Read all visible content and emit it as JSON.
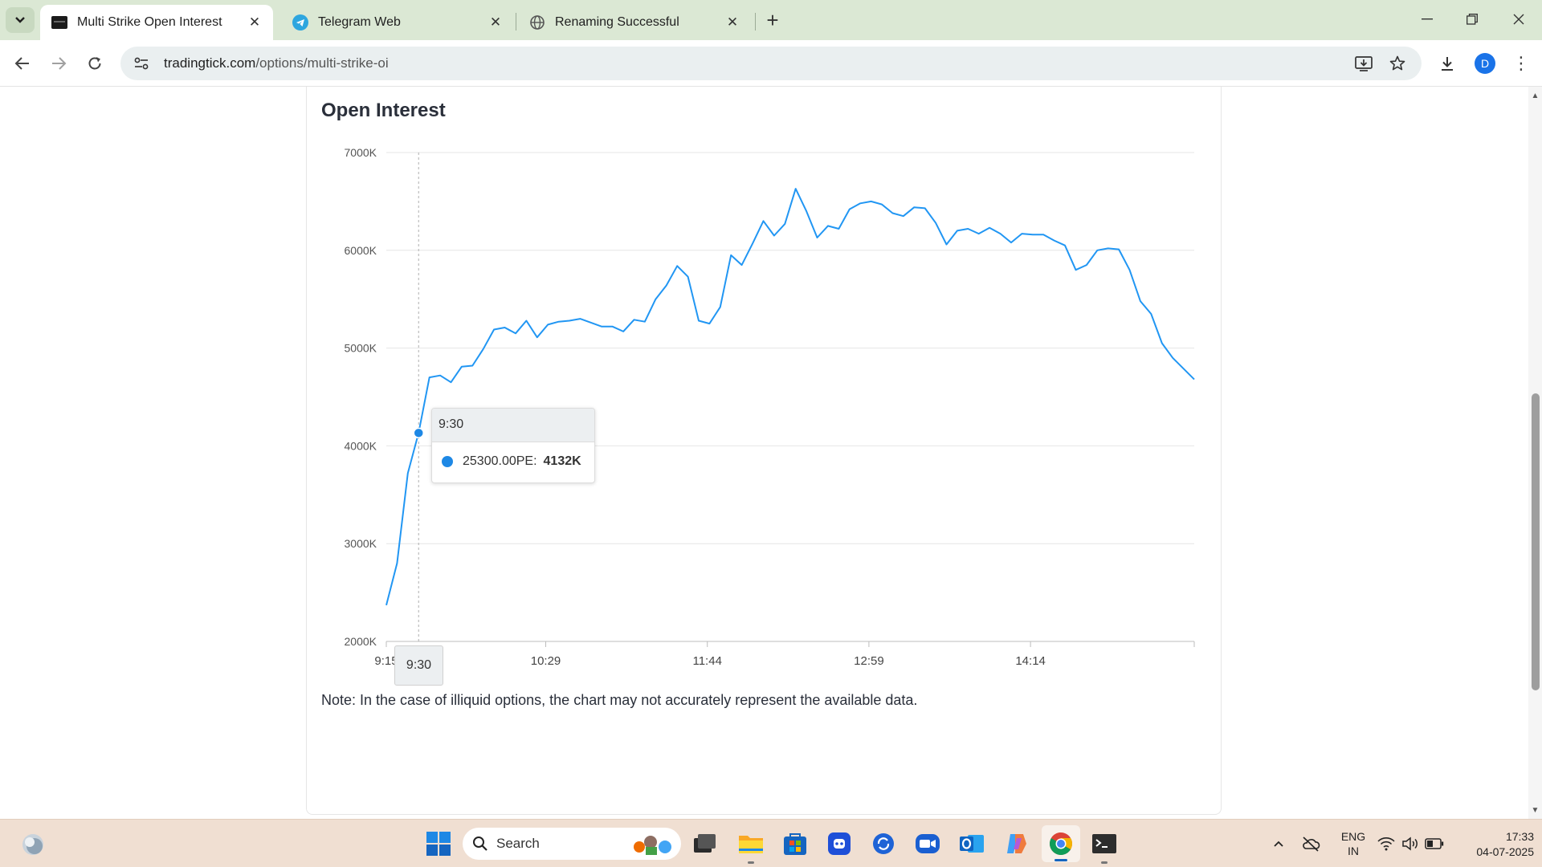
{
  "browser": {
    "tabs": [
      {
        "title": "Multi Strike Open Interest",
        "active": true
      },
      {
        "title": "Telegram Web",
        "active": false
      },
      {
        "title": "Renaming Successful",
        "active": false
      }
    ],
    "url_host": "tradingtick.com",
    "url_path": "/options/multi-strike-oi",
    "profile_initial": "D",
    "colors": {
      "tab_strip": "#dbe8d4",
      "accent": "#1a73e8"
    }
  },
  "page": {
    "card_title": "Open Interest",
    "note": "Note: In the case of illiquid options, the chart may not accurately represent the available data."
  },
  "tooltip": {
    "time": "9:30",
    "series_label": "25300.00PE:",
    "value": "4132K",
    "crosshair_label": "9:30"
  },
  "chart_data": {
    "type": "line",
    "title": "Open Interest",
    "xlabel": "",
    "ylabel": "",
    "ylim": [
      2000,
      7000
    ],
    "y_unit": "K",
    "y_ticks": [
      "2000K",
      "3000K",
      "4000K",
      "5000K",
      "6000K",
      "7000K"
    ],
    "x_ticks": [
      "9:15",
      "10:29",
      "11:44",
      "12:59",
      "14:14"
    ],
    "grid": true,
    "legend": "none",
    "line_color": "#2196f3",
    "series": [
      {
        "name": "25300.00PE",
        "x": [
          "9:15",
          "9:20",
          "9:25",
          "9:30",
          "9:35",
          "9:40",
          "9:45",
          "9:50",
          "9:55",
          "10:00",
          "10:05",
          "10:10",
          "10:15",
          "10:20",
          "10:25",
          "10:30",
          "10:35",
          "10:40",
          "10:45",
          "10:50",
          "10:55",
          "11:00",
          "11:05",
          "11:10",
          "11:15",
          "11:20",
          "11:25",
          "11:30",
          "11:35",
          "11:40",
          "11:45",
          "11:50",
          "11:55",
          "12:00",
          "12:05",
          "12:10",
          "12:15",
          "12:20",
          "12:25",
          "12:30",
          "12:35",
          "12:40",
          "12:45",
          "12:50",
          "12:55",
          "13:00",
          "13:05",
          "13:10",
          "13:15",
          "13:20",
          "13:25",
          "13:30",
          "13:35",
          "13:40",
          "13:45",
          "13:50",
          "13:55",
          "14:00",
          "14:05",
          "14:10",
          "14:15",
          "14:20",
          "14:25",
          "14:30",
          "14:35",
          "14:40",
          "14:45",
          "14:50",
          "14:55",
          "15:00",
          "15:05",
          "15:10",
          "15:15",
          "15:20",
          "15:25",
          "15:30"
        ],
        "values": [
          2370,
          2800,
          3720,
          4132,
          4700,
          4720,
          4650,
          4810,
          4820,
          4990,
          5190,
          5210,
          5150,
          5280,
          5110,
          5240,
          5270,
          5280,
          5300,
          5260,
          5220,
          5220,
          5170,
          5290,
          5270,
          5500,
          5640,
          5840,
          5730,
          5280,
          5250,
          5420,
          5950,
          5850,
          6070,
          6300,
          6150,
          6270,
          6630,
          6400,
          6130,
          6250,
          6220,
          6420,
          6480,
          6500,
          6470,
          6380,
          6350,
          6440,
          6430,
          6280,
          6060,
          6200,
          6220,
          6170,
          6230,
          6170,
          6080,
          6170,
          6160,
          6160,
          6100,
          6050,
          5800,
          5850,
          6000,
          6020,
          6010,
          5800,
          5480,
          5350,
          5050,
          4900,
          4790,
          4680
        ]
      }
    ],
    "highlight": {
      "x": "9:30",
      "value": 4132
    }
  },
  "taskbar": {
    "search_label": "Search",
    "lang_line1": "ENG",
    "lang_line2": "IN",
    "time": "17:33",
    "date": "04-07-2025"
  }
}
